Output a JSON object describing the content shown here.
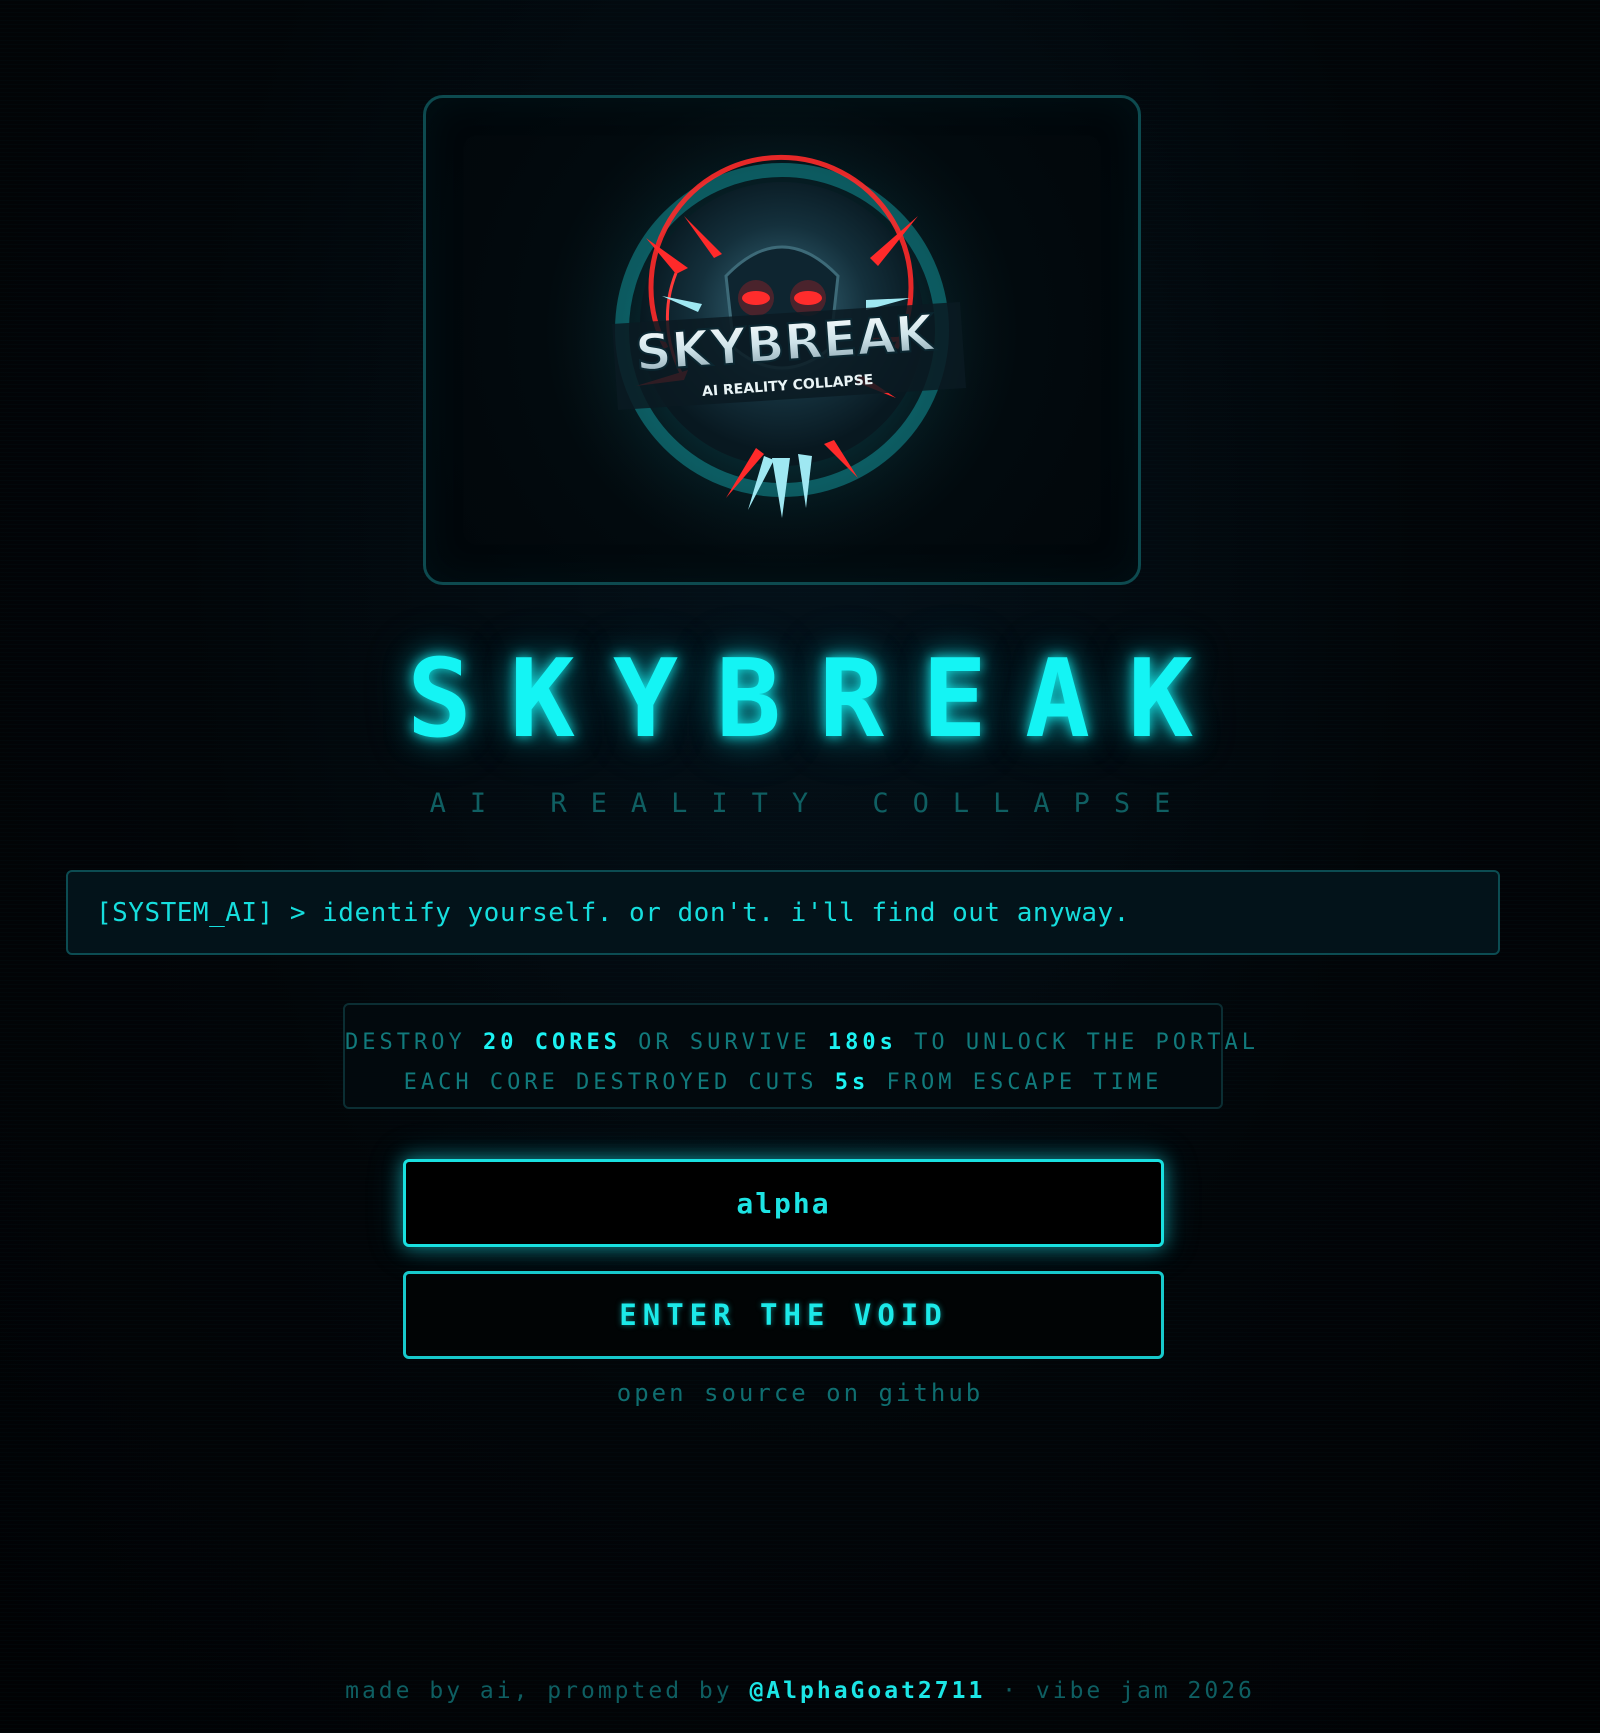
{
  "logo": {
    "image_name": "skybreak-logo-image",
    "title": "SKYBREAK",
    "subtitle": "AI REALITY COLLAPSE"
  },
  "title": "SKYBREAK",
  "subtitle": "AI REALITY COLLAPSE",
  "system_message": "[SYSTEM_AI] > identify yourself. or don't. i'll find out anyway.",
  "objective": {
    "line1": {
      "part1": "DESTROY ",
      "highlight1": "20 CORES",
      "part2": " OR SURVIVE ",
      "highlight2": "180s",
      "part3": " TO UNLOCK THE PORTAL"
    },
    "line2": {
      "part1": "EACH CORE DESTROYED CUTS ",
      "highlight1": "5s",
      "part2": " FROM ESCAPE TIME"
    }
  },
  "name_input": {
    "value": "alpha"
  },
  "enter_button": {
    "label": "ENTER THE VOID"
  },
  "github_link": "open source on github",
  "footer": {
    "prefix": "made by ai, prompted by ",
    "handle": "@AlphaGoat2711",
    "suffix": " · vibe jam 2026"
  },
  "colors": {
    "accent": "#14f4f4",
    "dim_accent": "#0f5f62",
    "border": "#0c4c52",
    "background": "#020406",
    "logo_red": "#ff2a2a"
  }
}
